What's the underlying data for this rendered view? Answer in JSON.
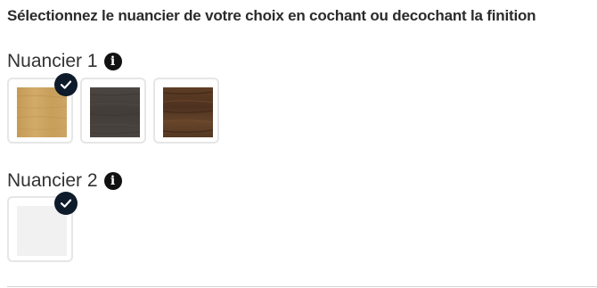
{
  "instructions": "Sélectionnez le nuancier de votre choix en cochant ou decochant la finition",
  "nuanciers": [
    {
      "title": "Nuancier 1",
      "info_icon": "info-icon",
      "swatches": [
        {
          "name": "light-oak",
          "selected": true
        },
        {
          "name": "dark-grey-wood",
          "selected": false
        },
        {
          "name": "walnut-wood",
          "selected": false
        }
      ]
    },
    {
      "title": "Nuancier 2",
      "info_icon": "info-icon",
      "swatches": [
        {
          "name": "white",
          "selected": true
        }
      ]
    }
  ],
  "colors": {
    "check_badge": "#0d1b2a",
    "swatch_border": "#e6e6e6",
    "light_oak": "#c9a25f",
    "dark_grey_wood": "#4a4440",
    "walnut_wood": "#5a3b24",
    "white": "#f2f1f1"
  }
}
